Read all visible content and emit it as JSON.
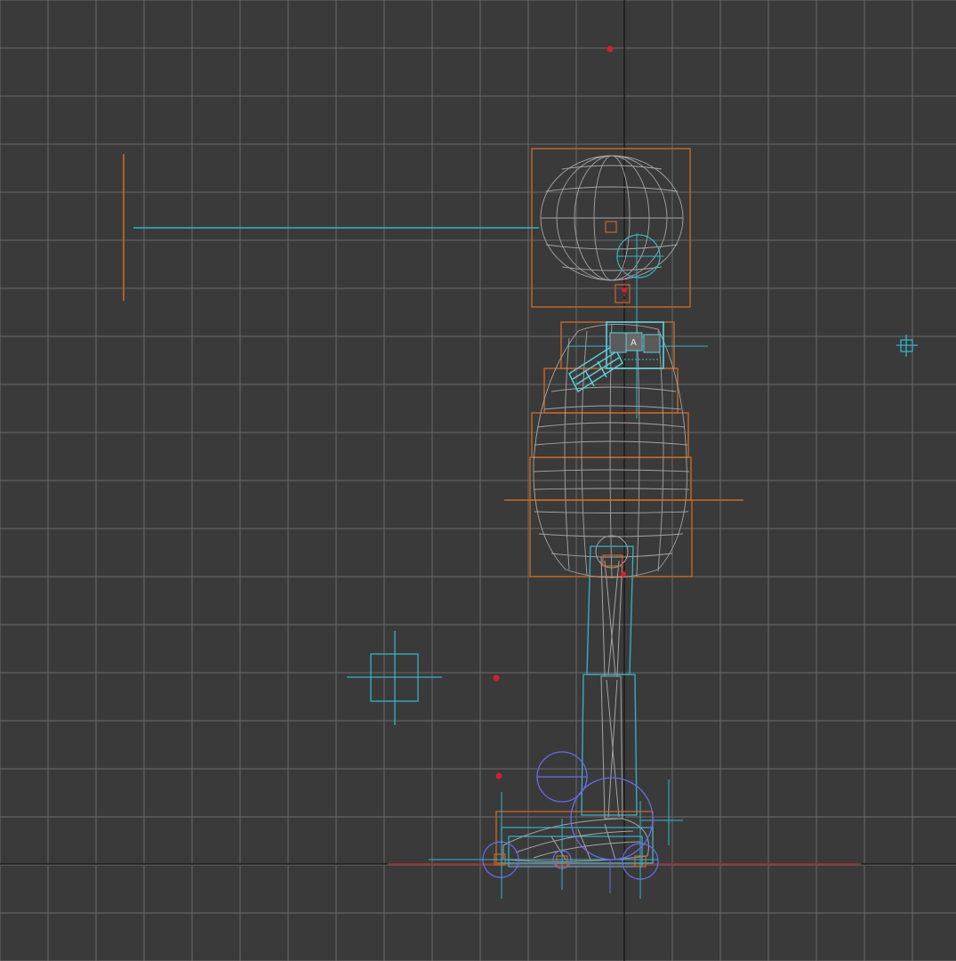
{
  "viewport": {
    "label": "",
    "background_color": "#3a3a3a",
    "grid_color": "#6a6a6a",
    "axis_color": "#111111",
    "ground_axis_color": "#b0303a"
  },
  "colors": {
    "bounding_box": "#c46a2c",
    "rig_helper": "#35b4c8",
    "mesh_wire": "#a4a4a4",
    "ik_goal": "#6a6af0",
    "selected": "#5fd0e0",
    "pivot_marker": "#d02030"
  },
  "head_badge": {
    "letter": "A"
  },
  "scene_objects": [
    "head-bounding-box",
    "head-wire-sphere",
    "look-at-line",
    "look-at-target-bar",
    "torso-bounding-boxes",
    "torso-wire-mesh",
    "pelvis-bar",
    "arm-controller",
    "leg-bones",
    "foot-wire",
    "foot-rollers",
    "ik-circles",
    "point-helper-left",
    "point-helper-right",
    "pivot-markers"
  ]
}
